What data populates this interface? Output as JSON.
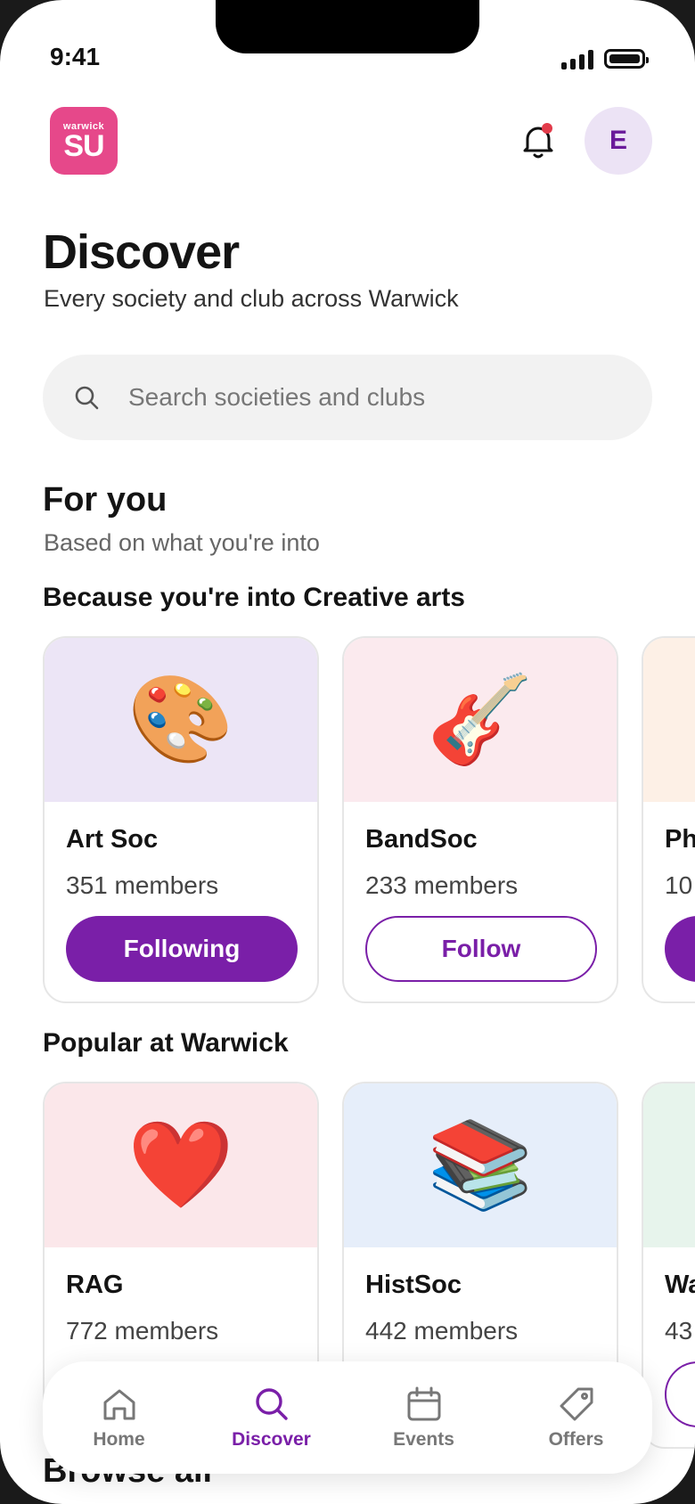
{
  "status_bar": {
    "time": "9:41"
  },
  "header": {
    "logo_small": "warwick",
    "logo_big": "SU",
    "avatar_initial": "E"
  },
  "page": {
    "title": "Discover",
    "subtitle": "Every society and club across Warwick"
  },
  "search": {
    "placeholder": "Search societies and clubs"
  },
  "for_you": {
    "title": "For you",
    "subtitle": "Based on what you're into",
    "row_title": "Because you're into Creative arts",
    "cards": [
      {
        "emoji": "🎨",
        "name": "Art Soc",
        "members": "351 members",
        "button": "Following",
        "banner_color": "#ece5f6"
      },
      {
        "emoji": "🎸",
        "name": "BandSoc",
        "members": "233 members",
        "button": "Follow",
        "banner_color": "#fbeaee"
      },
      {
        "emoji": "",
        "name": "Ph",
        "members": "10",
        "button": "",
        "banner_color": "#fdf0e6"
      }
    ]
  },
  "popular": {
    "row_title": "Popular at Warwick",
    "cards": [
      {
        "emoji": "❤️",
        "name": "RAG",
        "members": "772 members",
        "banner_color": "#fbe7ea"
      },
      {
        "emoji": "📚",
        "name": "HistSoc",
        "members": "442 members",
        "banner_color": "#e6eefa"
      },
      {
        "emoji": "",
        "name": "Wa",
        "members": "43",
        "banner_color": "#e7f4ec"
      }
    ]
  },
  "browse": {
    "title": "Browse all"
  },
  "nav": {
    "items": [
      {
        "label": "Home",
        "icon": "home-icon"
      },
      {
        "label": "Discover",
        "icon": "search-icon"
      },
      {
        "label": "Events",
        "icon": "calendar-icon"
      },
      {
        "label": "Offers",
        "icon": "tag-icon"
      }
    ],
    "active": "Discover"
  },
  "colors": {
    "accent": "#7a1fa8",
    "logo": "#e6488a",
    "notification_dot": "#e23b4a"
  }
}
